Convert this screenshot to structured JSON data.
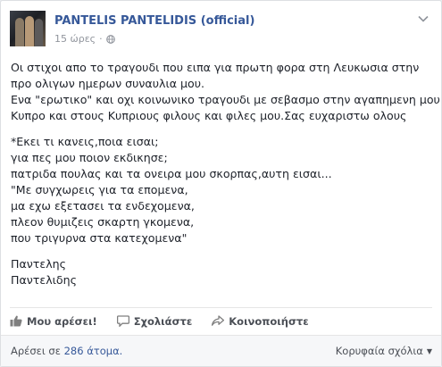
{
  "post": {
    "page_name": "PANTELIS PANTELIDIS (official)",
    "time": "15 ώρες",
    "separator": "·",
    "paragraphs": [
      [
        "Οι στιχοι απο το τραγουδι που ειπα για πρωτη φορα στη Λευκωσια στην",
        "προ ολιγων ημερων συναυλια μου.",
        "Ενα \"ερωτικο\" και οχι κοινωνικο τραγουδι με σεβασμο στην αγαπημενη μου",
        "Κυπρο και στους Κυπριους φιλους και φιλες μου.Σας ευχαριστω ολους"
      ],
      [
        "*Εκει τι κανεις,ποια εισαι;",
        "για πες μου ποιον εκδικησε;",
        "πατριδα πουλας και τα ονειρα μου σκορπας,αυτη εισαι...",
        "\"Με συγχωρεις για τα επομενα,",
        "μα εχω εξετασει τα ενδεχομενα,",
        "πλεον θυμιζεις σκαρτη γκομενα,",
        "που τριγυρνα στα κατεχομενα\""
      ],
      [
        "Παντελης",
        "Παντελιδης"
      ]
    ]
  },
  "actions": {
    "like": "Μου αρέσει!",
    "comment": "Σχολιάστε",
    "share": "Κοινοποιήστε"
  },
  "footer": {
    "likes_prefix": "Αρέσει σε ",
    "likes_count": "286 άτομα.",
    "sort_label": "Κορυφαία σχόλια"
  },
  "colors": {
    "link": "#365899",
    "text": "#1d2129",
    "muted": "#90949c"
  },
  "icons": {
    "privacy": "globe-icon",
    "options": "chevron-down-icon",
    "like": "thumbs-up-icon",
    "comment": "comment-icon",
    "share": "share-icon"
  }
}
